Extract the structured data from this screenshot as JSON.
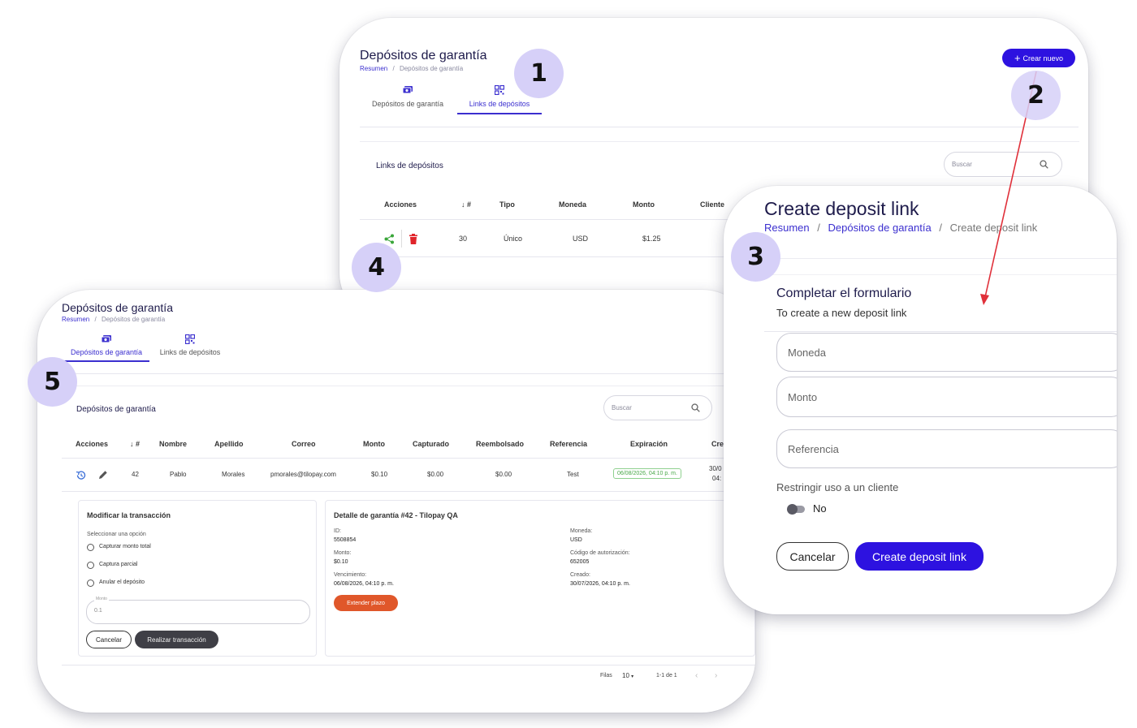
{
  "card1": {
    "title": "Depósitos de garantía",
    "breadcrumb": [
      "Resumen",
      "/",
      "Depósitos de garantía"
    ],
    "create_button": "Crear nuevo",
    "tabs": [
      {
        "label": "Depósitos de garantía",
        "icon": "cash-icon",
        "active": false
      },
      {
        "label": "Links de depósitos",
        "icon": "qr-code-icon",
        "active": true
      }
    ],
    "panel_title": "Links de depósitos",
    "search_placeholder": "Buscar",
    "columns": [
      "Acciones",
      "#",
      "Tipo",
      "Moneda",
      "Monto",
      "Cliente"
    ],
    "row": {
      "id": "30",
      "tipo": "Único",
      "moneda": "USD",
      "monto": "$1.25"
    }
  },
  "card2": {
    "title": "Depósitos de garantía",
    "breadcrumb": [
      "Resumen",
      "/",
      "Depósitos de garantía"
    ],
    "tabs": [
      {
        "label": "Depósitos de garantía",
        "icon": "cash-icon",
        "active": true
      },
      {
        "label": "Links de depósitos",
        "icon": "qr-code-icon",
        "active": false
      }
    ],
    "panel_title": "Depósitos de garantía",
    "search_placeholder": "Buscar",
    "columns": [
      "Acciones",
      "#",
      "Nombre",
      "Apellido",
      "Correo",
      "Monto",
      "Capturado",
      "Reembolsado",
      "Referencia",
      "Expiración",
      "Cre"
    ],
    "row": {
      "id": "42",
      "nombre": "Pablo",
      "apellido": "Morales",
      "correo": "pmorales@tilopay.com",
      "monto": "$0.10",
      "capturado": "$0.00",
      "reembolsado": "$0.00",
      "referencia": "Test",
      "expiracion": "06/08/2026, 04:10 p. m.",
      "creado_1": "30/0",
      "creado_2": "04:"
    },
    "modify": {
      "title": "Modificar la transacción",
      "subtitle": "Seleccionar una opción",
      "options": [
        "Capturar monto total",
        "Captura parcial",
        "Anular el depósito"
      ],
      "amount_label": "Monto",
      "amount_value": "0.1",
      "cancel": "Cancelar",
      "submit": "Realizar transacción"
    },
    "detail": {
      "title": "Detalle de garantía #42 - Tilopay QA",
      "id_label": "ID:",
      "id_value": "5508854",
      "monto_label": "Monto:",
      "monto_value": "$0.10",
      "venc_label": "Vencimiento:",
      "venc_value": "06/08/2026, 04:10 p. m.",
      "moneda_label": "Moneda:",
      "moneda_value": "USD",
      "auth_label": "Código de autorización:",
      "auth_value": "652005",
      "creado_label": "Creado:",
      "creado_value": "30/07/2026, 04:10 p. m.",
      "extend_button": "Extender plazo"
    },
    "pagination": {
      "rows_label": "Filas",
      "rows_value": "10",
      "range": "1-1 de 1"
    }
  },
  "card3": {
    "title": "Create deposit link",
    "breadcrumb": [
      "Resumen",
      "/",
      "Depósitos de garantía",
      "/",
      "Create deposit link"
    ],
    "form_title": "Completar el formulario",
    "form_subtitle": "To create a new deposit link",
    "fields": [
      "Moneda",
      "Monto",
      "Referencia"
    ],
    "restrict_label": "Restringir uso a un cliente",
    "toggle_value": "No",
    "cancel": "Cancelar",
    "submit": "Create deposit link"
  },
  "badges": [
    "1",
    "2",
    "3",
    "4",
    "5"
  ],
  "colors": {
    "primary": "#2d12e0",
    "badge": "#d6d0f8",
    "delete": "#e0242a",
    "share": "#3aa63a",
    "extend": "#e0572a",
    "arrow": "#e0303a"
  }
}
